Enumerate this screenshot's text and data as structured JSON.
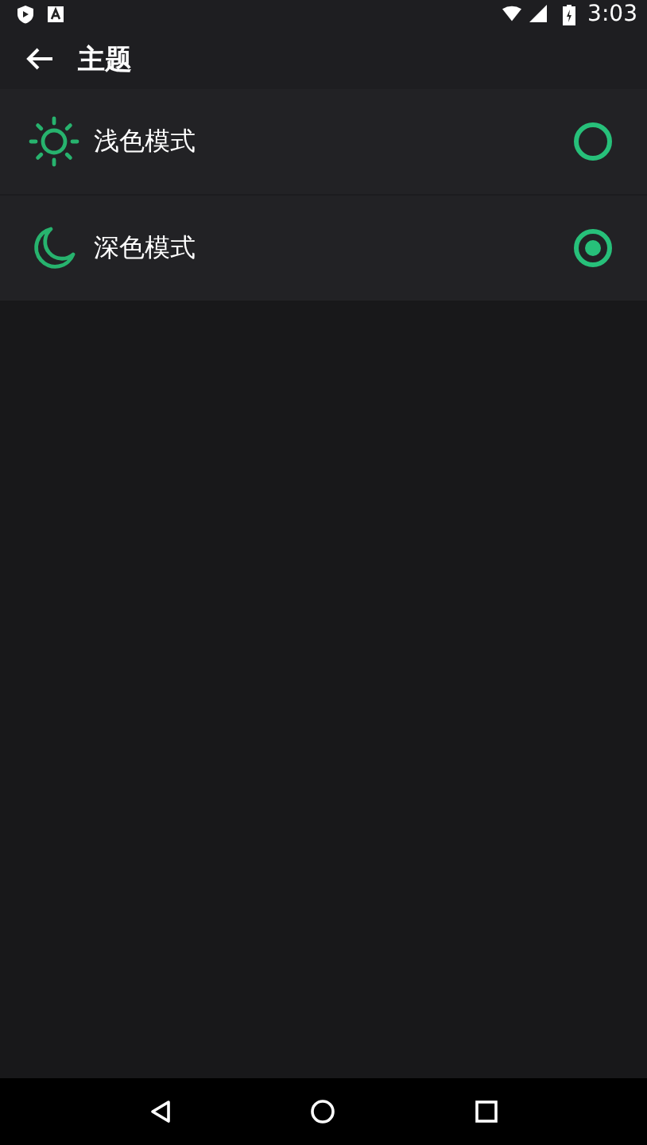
{
  "status_bar": {
    "time": "3:03"
  },
  "toolbar": {
    "title": "主题"
  },
  "options": [
    {
      "kind": "light",
      "label": "浅色模式",
      "selected": false
    },
    {
      "kind": "dark",
      "label": "深色模式",
      "selected": true
    }
  ]
}
